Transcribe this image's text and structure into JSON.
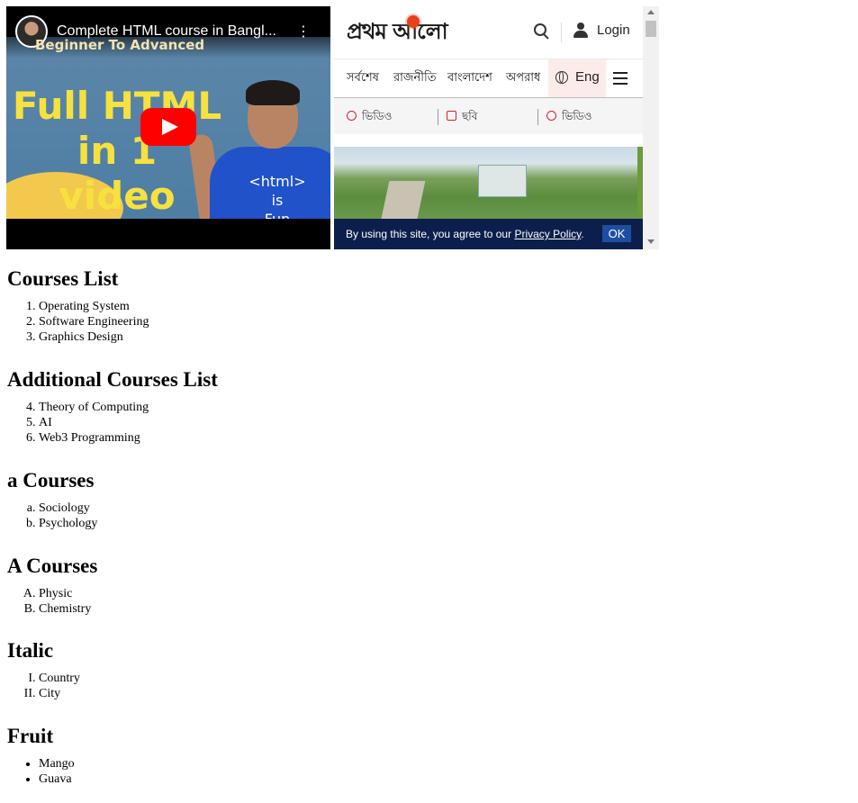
{
  "youtube": {
    "title": "Complete HTML course in Bangl...",
    "menu_glyph": "⋮",
    "thumb_subtitle": "Beginner To Advanced",
    "thumb_headline": [
      "Full HTML",
      "in 1",
      "video"
    ],
    "shirt_text": [
      "<html>",
      "is",
      "Fun"
    ],
    "brand_color": "#ff0000"
  },
  "prothomalo": {
    "logo": "প্রথম আলো",
    "login": "Login",
    "nav": [
      "সর্বশেষ",
      "রাজনীতি",
      "বাংলাদেশ",
      "অপরাধ"
    ],
    "language": "Eng",
    "media": [
      {
        "label": "ভিডিও",
        "icon": "play-circle-icon"
      },
      {
        "label": "ছবি",
        "icon": "camera-icon"
      },
      {
        "label": "ভিডিও",
        "icon": "play-circle-icon"
      }
    ],
    "cookie_text": "By using this site, you agree to our ",
    "cookie_link": "Privacy Policy",
    "cookie_end": ".",
    "ok": "OK",
    "accent": "#d62027",
    "banner_color": "#0c1f4c"
  },
  "sections": [
    {
      "heading": "Courses List",
      "items": [
        "Operating System",
        "Software Engineering",
        "Graphics Design"
      ]
    },
    {
      "heading": "Additional Courses List",
      "items": [
        "Theory of Computing",
        "AI",
        "Web3 Programming"
      ]
    },
    {
      "heading": "a Courses",
      "items": [
        "Sociology",
        "Psychology"
      ]
    },
    {
      "heading": "A Courses",
      "items": [
        "Physic",
        "Chemistry"
      ]
    },
    {
      "heading": "Italic",
      "items": [
        "Country",
        "City"
      ]
    },
    {
      "heading": "Fruit",
      "items": [
        "Mango",
        "Guava"
      ]
    }
  ]
}
